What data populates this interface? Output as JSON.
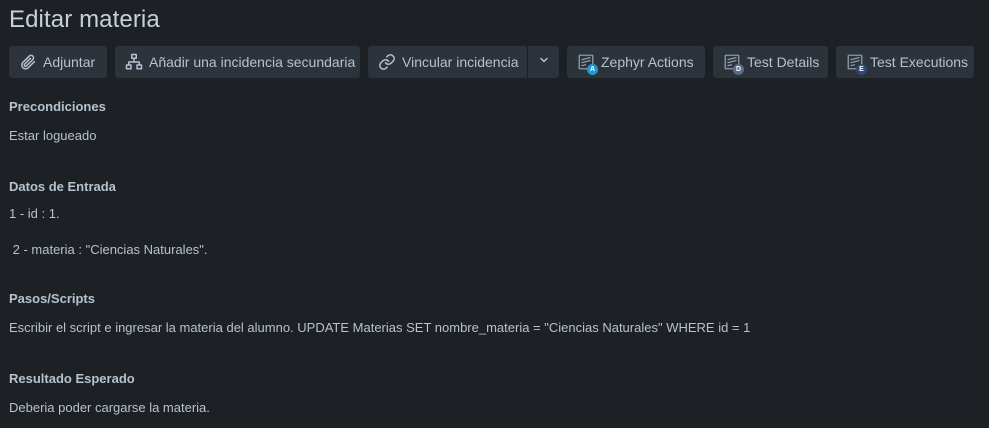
{
  "page": {
    "title": "Editar materia"
  },
  "toolbar": {
    "attach_label": "Adjuntar",
    "subtask_label": "Añadir una incidencia secundaria",
    "link_label": "Vincular incidencia",
    "zephyr_actions_label": "Zephyr Actions",
    "zephyr_actions_badge": "A",
    "test_details_label": "Test Details",
    "test_details_badge": "D",
    "test_executions_label": "Test Executions",
    "test_executions_badge": "E",
    "badge_colors": {
      "actions": "#1d9bd1",
      "details": "#5b6b8c",
      "executions": "#2f4a7a"
    }
  },
  "sections": {
    "preconditions": {
      "label": "Precondiciones",
      "lines": [
        "Estar logueado"
      ]
    },
    "input_data": {
      "label": "Datos de Entrada",
      "lines": [
        "1 - id : 1.",
        " 2 - materia : \"Ciencias Naturales\"."
      ]
    },
    "steps": {
      "label": "Pasos/Scripts",
      "lines": [
        "Escribir el script e ingresar la materia del alumno. UPDATE Materias SET nombre_materia = \"Ciencias Naturales\" WHERE id = 1"
      ]
    },
    "expected": {
      "label": "Resultado Esperado",
      "lines": [
        "Deberia poder cargarse la materia."
      ]
    }
  },
  "icons": {
    "attach": "paperclip-icon",
    "subtask": "hierarchy-icon",
    "link": "link-icon",
    "caret": "chevron-down-icon",
    "zephyr": "zephyr-icon"
  }
}
